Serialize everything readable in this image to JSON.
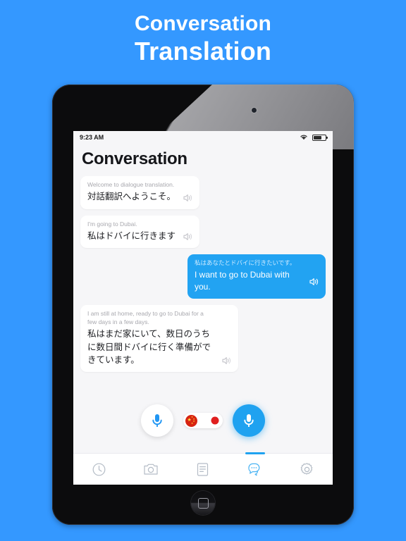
{
  "promo": {
    "line1": "Conversation",
    "line2": "Translation",
    "background_color": "#3498ff",
    "text_color": "#ffffff"
  },
  "device": {
    "type": "tablet",
    "frame_color": "#0c0c0d",
    "home_button": "home-button",
    "camera": "front-camera"
  },
  "statusbar": {
    "time": "9:23 AM",
    "wifi_icon": "wifi-icon",
    "battery_icon": "battery-icon"
  },
  "app": {
    "title": "Conversation",
    "background_color": "#f6f6f8",
    "accent_color": "#1fa2f0"
  },
  "conversation": {
    "messages": [
      {
        "side": "left",
        "source": "Welcome to dialogue translation.",
        "target": "対話翻訳へようこそ。",
        "speaker_icon": "speaker-icon"
      },
      {
        "side": "left",
        "source": "I'm going to Dubai.",
        "target": "私はドバイに行きます",
        "speaker_icon": "speaker-icon"
      },
      {
        "side": "right",
        "source": "私はあなたとドバイに行きたいです。",
        "target": "I want to go to Dubai with you.",
        "speaker_icon": "speaker-icon"
      },
      {
        "side": "left",
        "source": "I am still at home, ready to go to Dubai for a few days in a few days.",
        "target": "私はまだ家にいて、数日のうちに数日間ドバイに行く準備ができています。",
        "speaker_icon": "speaker-icon"
      }
    ]
  },
  "controls": {
    "mic_left": "microphone-left-button",
    "mic_right": "microphone-right-button",
    "language_toggle": {
      "left_flag": "china-flag",
      "right_flag": "japan-flag"
    }
  },
  "tabbar": {
    "items": [
      {
        "name": "history",
        "icon": "clock-icon",
        "active": false
      },
      {
        "name": "camera",
        "icon": "camera-icon",
        "active": false
      },
      {
        "name": "text",
        "icon": "document-icon",
        "active": false
      },
      {
        "name": "conversation",
        "icon": "chat-bubbles-icon",
        "active": true
      },
      {
        "name": "settings",
        "icon": "gear-icon",
        "active": false
      }
    ]
  }
}
